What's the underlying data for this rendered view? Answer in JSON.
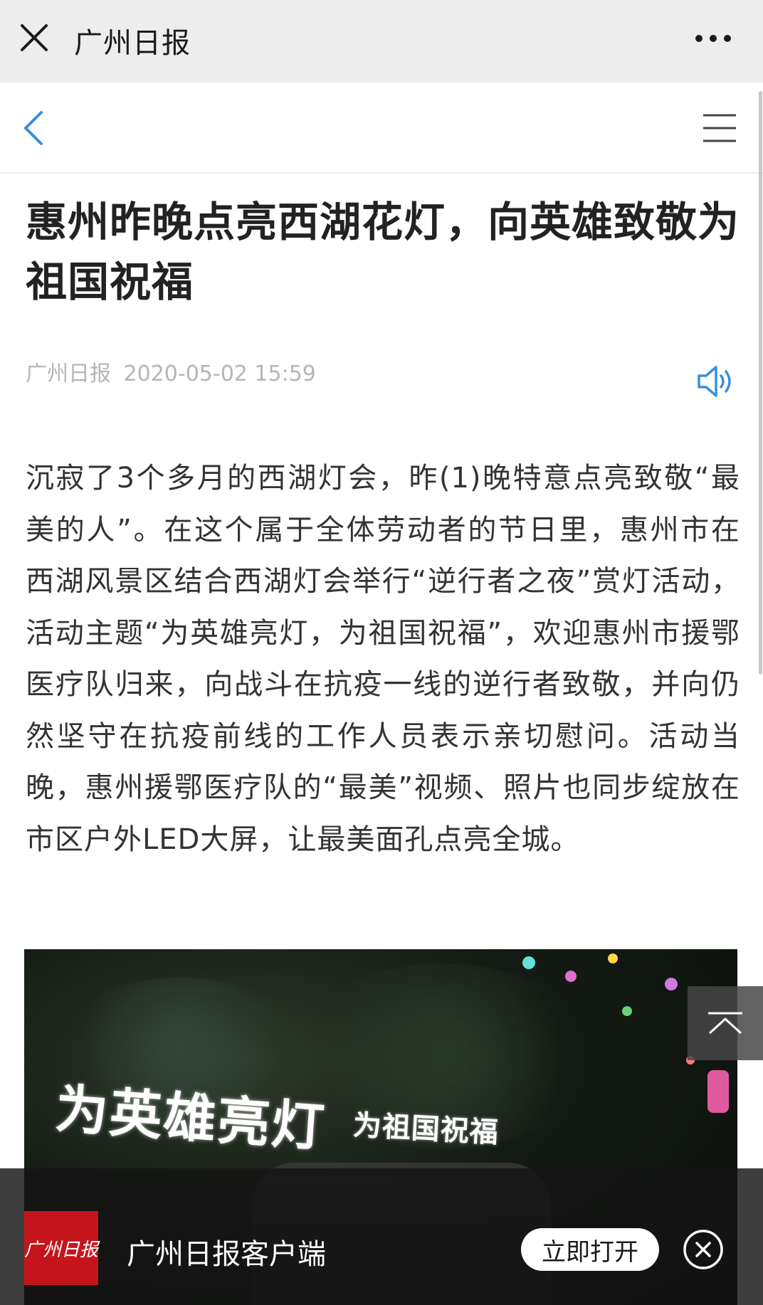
{
  "topbar": {
    "title": "广州日报",
    "close_icon": "close-icon",
    "more_icon": "more-icon"
  },
  "navbar": {
    "back_icon": "chevron-left-icon",
    "menu_icon": "menu-icon"
  },
  "article": {
    "title": "惠州昨晚点亮西湖花灯，向英雄致敬为祖国祝福",
    "source": "广州日报",
    "datetime": "2020-05-02 15:59",
    "audio_icon": "speaker-icon",
    "body": "沉寂了3个多月的西湖灯会，昨(1)晚特意点亮致敬“最美的人”。在这个属于全体劳动者的节日里，惠州市在西湖风景区结合西湖灯会举行“逆行者之夜”赏灯活动，活动主题“为英雄亮灯，为祖国祝福”，欢迎惠州市援鄂医疗队归来，向战斗在抗疫一线的逆行者致敬，并向仍然坚守在抗疫前线的工作人员表示亲切慰问。活动当晚，惠州援鄂医疗队的“最美”视频、照片也同步绽放在市区户外LED大屏，让最美面孔点亮全城。"
  },
  "photo": {
    "sign_main": "为英雄亮灯",
    "sign_sub": "为祖国祝福"
  },
  "scroll_top_icon": "chevron-up-icon",
  "banner": {
    "logo_text": "广州日报",
    "app_name": "广州日报客户端",
    "open_label": "立即打开",
    "close_icon": "close-circle-icon"
  },
  "colors": {
    "accent_blue": "#3a8fde",
    "banner_bg": "#141414",
    "logo_red": "#c4151c"
  }
}
